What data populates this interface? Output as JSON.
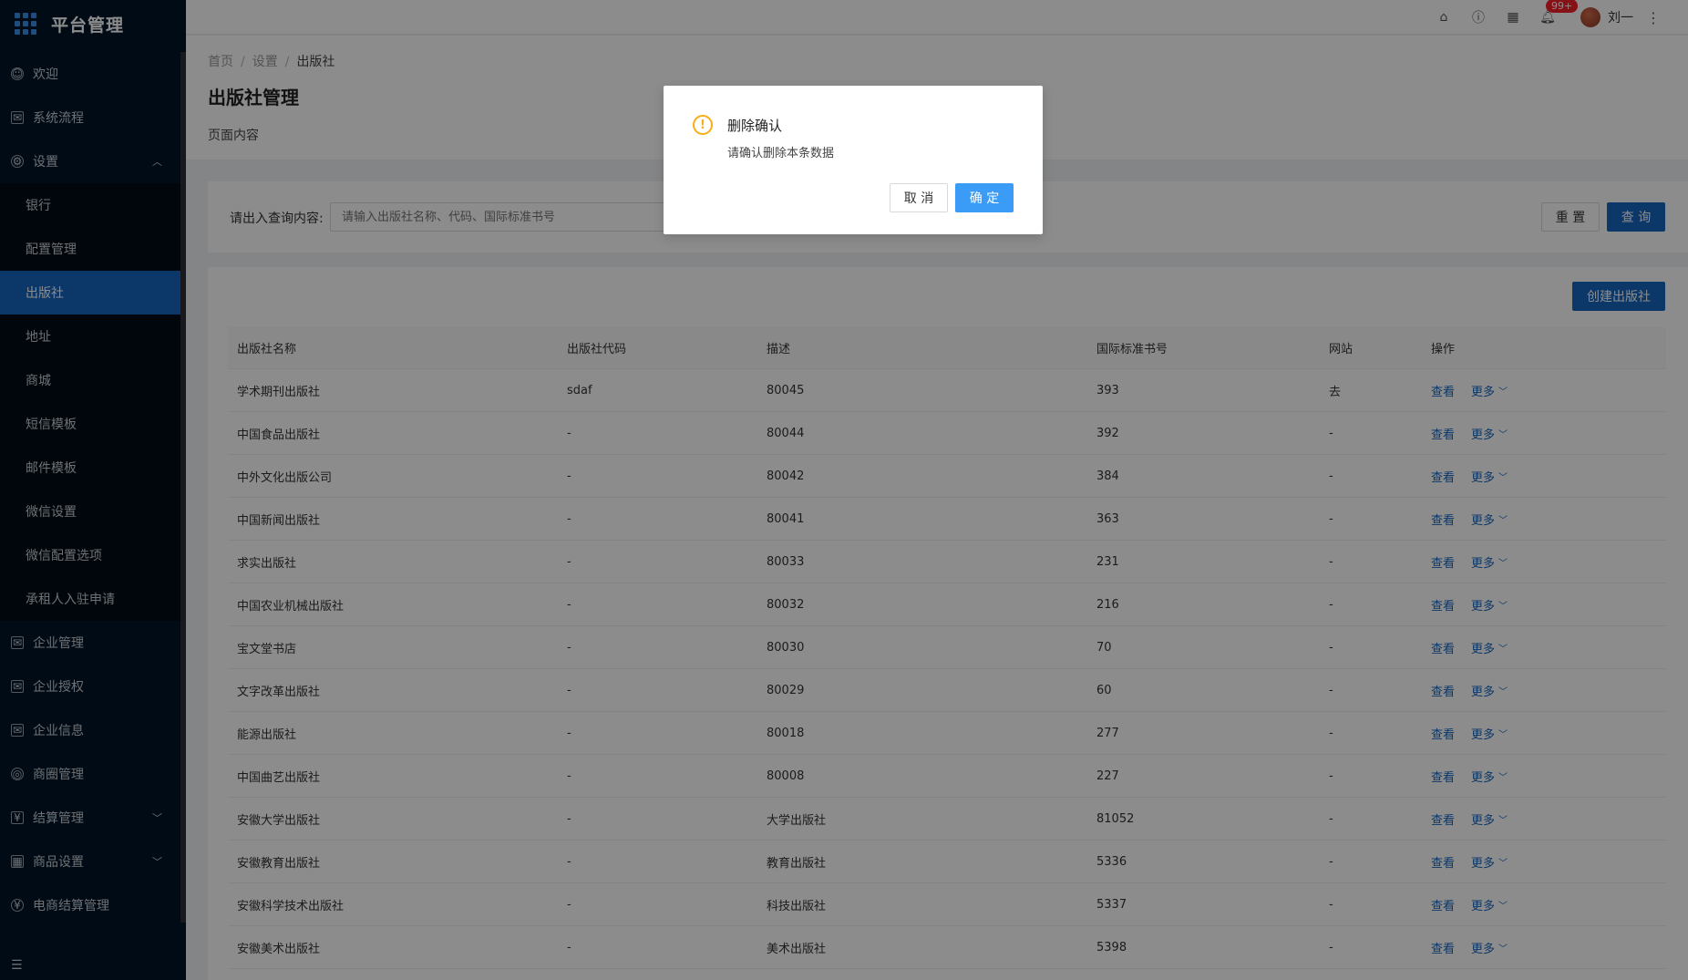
{
  "app": {
    "title": "平台管理"
  },
  "sidebar": {
    "items": [
      {
        "label": "欢迎",
        "icon": "smile-icon"
      },
      {
        "label": "系统流程",
        "icon": "mail-icon"
      },
      {
        "label": "设置",
        "icon": "gear-icon"
      },
      {
        "label": "企业管理",
        "icon": "mail-icon"
      },
      {
        "label": "企业授权",
        "icon": "mail-icon"
      },
      {
        "label": "企业信息",
        "icon": "mail-icon"
      },
      {
        "label": "商圈管理",
        "icon": "compass-icon"
      },
      {
        "label": "结算管理",
        "icon": "calc-icon"
      },
      {
        "label": "商品设置",
        "icon": "grid-icon"
      },
      {
        "label": "电商结算管理",
        "icon": "money-icon"
      }
    ],
    "settings_children": [
      {
        "label": "银行"
      },
      {
        "label": "配置管理"
      },
      {
        "label": "出版社"
      },
      {
        "label": "地址"
      },
      {
        "label": "商城"
      },
      {
        "label": "短信模板"
      },
      {
        "label": "邮件模板"
      },
      {
        "label": "微信设置"
      },
      {
        "label": "微信配置选项"
      },
      {
        "label": "承租人入驻申请"
      }
    ]
  },
  "header": {
    "notification_count": "99+",
    "user_name": "刘一"
  },
  "breadcrumb": [
    "首页",
    "设置",
    "出版社"
  ],
  "page": {
    "title": "出版社管理",
    "description": "页面内容"
  },
  "search": {
    "label": "请出入查询内容:",
    "placeholder": "请输入出版社名称、代码、国际标准书号",
    "reset_label": "重 置",
    "query_label": "查 询"
  },
  "table": {
    "create_label": "创建出版社",
    "columns": [
      "出版社名称",
      "出版社代码",
      "描述",
      "国际标准书号",
      "网站",
      "操作"
    ],
    "view_label": "查看",
    "more_label": "更多",
    "rows": [
      {
        "name": "学术期刊出版社",
        "code": "sdaf",
        "desc": "80045",
        "isbn": "393",
        "site": "去"
      },
      {
        "name": "中国食品出版社",
        "code": "-",
        "desc": "80044",
        "isbn": "392",
        "site": "-"
      },
      {
        "name": "中外文化出版公司",
        "code": "-",
        "desc": "80042",
        "isbn": "384",
        "site": "-"
      },
      {
        "name": "中国新闻出版社",
        "code": "-",
        "desc": "80041",
        "isbn": "363",
        "site": "-"
      },
      {
        "name": "求实出版社",
        "code": "-",
        "desc": "80033",
        "isbn": "231",
        "site": "-"
      },
      {
        "name": "中国农业机械出版社",
        "code": "-",
        "desc": "80032",
        "isbn": "216",
        "site": "-"
      },
      {
        "name": "宝文堂书店",
        "code": "-",
        "desc": "80030",
        "isbn": "70",
        "site": "-"
      },
      {
        "name": "文字改革出版社",
        "code": "-",
        "desc": "80029",
        "isbn": "60",
        "site": "-"
      },
      {
        "name": "能源出版社",
        "code": "-",
        "desc": "80018",
        "isbn": "277",
        "site": "-"
      },
      {
        "name": "中国曲艺出版社",
        "code": "-",
        "desc": "80008",
        "isbn": "227",
        "site": "-"
      },
      {
        "name": "安徽大学出版社",
        "code": "-",
        "desc": "大学出版社",
        "isbn": "81052",
        "site": "-"
      },
      {
        "name": "安徽教育出版社",
        "code": "-",
        "desc": "教育出版社",
        "isbn": "5336",
        "site": "-"
      },
      {
        "name": "安徽科学技术出版社",
        "code": "-",
        "desc": "科技出版社",
        "isbn": "5337",
        "site": "-"
      },
      {
        "name": "安徽美术出版社",
        "code": "-",
        "desc": "美术出版社",
        "isbn": "5398",
        "site": "-"
      }
    ]
  },
  "modal": {
    "title": "删除确认",
    "content": "请确认删除本条数据",
    "cancel_label": "取 消",
    "ok_label": "确 定",
    "icon": "exclamation-circle-icon",
    "icon_color": "#faad14"
  },
  "colors": {
    "sidebar_bg": "#001529",
    "primary": "#1565c0",
    "modal_ok": "#3a9cf6"
  }
}
